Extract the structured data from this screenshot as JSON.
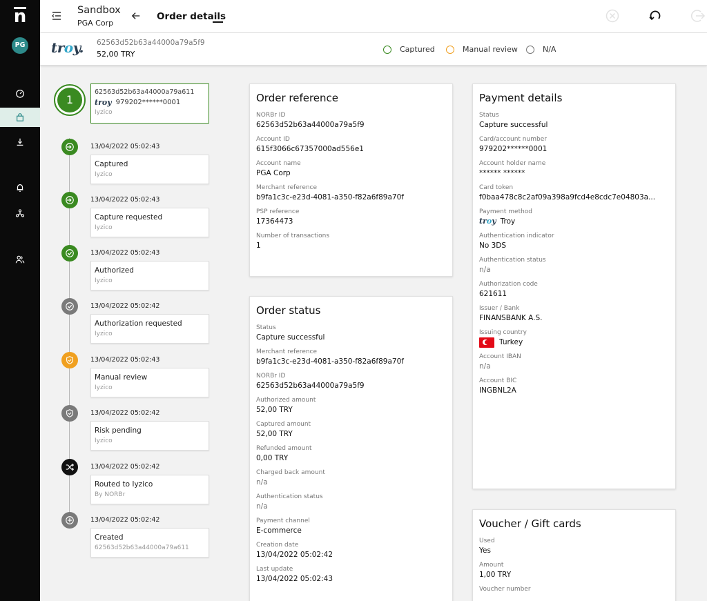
{
  "app": {
    "logo_letter": "n",
    "avatar_initials": "PG"
  },
  "nav": [
    {
      "name": "dashboard",
      "icon": "gauge-icon",
      "active": false
    },
    {
      "name": "orders",
      "icon": "bag-icon",
      "active": true
    },
    {
      "name": "download",
      "icon": "download-icon",
      "active": false
    },
    {
      "name": "alerts",
      "icon": "bell-icon",
      "active": false
    },
    {
      "name": "workflow",
      "icon": "network-icon",
      "active": false
    },
    {
      "name": "users",
      "icon": "users-icon",
      "active": false
    }
  ],
  "header": {
    "org_title": "Sandbox",
    "org_subtitle": "PGA Corp",
    "page_title": "Order details"
  },
  "summary": {
    "brand": "troy",
    "order_id": "62563d52b63a44000a79a5f9",
    "amount": "52,00 TRY",
    "legend": [
      {
        "label": "Captured",
        "color": "#3a8a21"
      },
      {
        "label": "Manual review",
        "color": "#f0a020"
      },
      {
        "label": "N/A",
        "color": "#777777"
      }
    ]
  },
  "timeline": {
    "first": {
      "number": "1",
      "id": "62563d52b63a44000a79a611",
      "card": "979202******0001",
      "psp": "Iyzico"
    },
    "events": [
      {
        "date": "13/04/2022 05:02:43",
        "title": "Captured",
        "sub": "Iyzico",
        "icon": "enter-icon",
        "color": "#3a8a21"
      },
      {
        "date": "13/04/2022 05:02:43",
        "title": "Capture requested",
        "sub": "Iyzico",
        "icon": "enter-icon",
        "color": "#3a8a21"
      },
      {
        "date": "13/04/2022 05:02:43",
        "title": "Authorized",
        "sub": "Iyzico",
        "icon": "check-icon",
        "color": "#3a8a21"
      },
      {
        "date": "13/04/2022 05:02:42",
        "title": "Authorization requested",
        "sub": "Iyzico",
        "icon": "check-icon",
        "color": "#777777"
      },
      {
        "date": "13/04/2022 05:02:43",
        "title": "Manual review",
        "sub": "Iyzico",
        "icon": "shield-check-icon",
        "color": "#f0a020"
      },
      {
        "date": "13/04/2022 05:02:42",
        "title": "Risk pending",
        "sub": "Iyzico",
        "icon": "shield-check-icon",
        "color": "#777777"
      },
      {
        "date": "13/04/2022 05:02:42",
        "title": "Routed to Iyzico",
        "sub": "By NORBr",
        "icon": "shuffle-icon",
        "color": "#111111"
      },
      {
        "date": "13/04/2022 05:02:42",
        "title": "Created",
        "sub": "62563d52b63a44000a79a611",
        "icon": "plus-icon",
        "color": "#777777"
      }
    ]
  },
  "order_reference": {
    "title": "Order reference",
    "fields": [
      {
        "label": "NORBr ID",
        "value": "62563d52b63a44000a79a5f9"
      },
      {
        "label": "Account ID",
        "value": "615f3066c67357000ad556e1"
      },
      {
        "label": "Account name",
        "value": "PGA Corp"
      },
      {
        "label": "Merchant reference",
        "value": "b9fa1c3c-e23d-4081-a350-f82a6f89a70f"
      },
      {
        "label": "PSP reference",
        "value": "17364473"
      },
      {
        "label": "Number of transactions",
        "value": "1"
      }
    ]
  },
  "order_status": {
    "title": "Order status",
    "fields": [
      {
        "label": "Status",
        "value": "Capture successful"
      },
      {
        "label": "Merchant reference",
        "value": "b9fa1c3c-e23d-4081-a350-f82a6f89a70f"
      },
      {
        "label": "NORBr ID",
        "value": "62563d52b63a44000a79a5f9"
      },
      {
        "label": "Authorized amount",
        "value": "52,00 TRY"
      },
      {
        "label": "Captured amount",
        "value": "52,00 TRY"
      },
      {
        "label": "Refunded amount",
        "value": "0,00 TRY"
      },
      {
        "label": "Charged back amount",
        "value": "n/a"
      },
      {
        "label": "Authentication status",
        "value": "n/a"
      },
      {
        "label": "Payment channel",
        "value": "E-commerce"
      },
      {
        "label": "Creation date",
        "value": "13/04/2022 05:02:42"
      },
      {
        "label": "Last update",
        "value": "13/04/2022 05:02:43"
      }
    ]
  },
  "payment_details": {
    "title": "Payment details",
    "fields": [
      {
        "label": "Status",
        "value": "Capture successful"
      },
      {
        "label": "Card/account number",
        "value": "979202******0001"
      },
      {
        "label": "Account holder name",
        "value": "****** ******"
      },
      {
        "label": "Card token",
        "value": "f0baa478c8c2af09a398a9fcd4e8cdc7e04803a..."
      },
      {
        "label": "Payment method",
        "value": "Troy",
        "badge": "troy"
      },
      {
        "label": "Authentication indicator",
        "value": "No 3DS"
      },
      {
        "label": "Authentication status",
        "value": "n/a"
      },
      {
        "label": "Authorization code",
        "value": "621611"
      },
      {
        "label": "Issuer / Bank",
        "value": "FINANSBANK A.S."
      },
      {
        "label": "Issuing country",
        "value": "Turkey",
        "badge": "flag"
      },
      {
        "label": "Account IBAN",
        "value": "n/a"
      },
      {
        "label": "Account BIC",
        "value": "INGBNL2A"
      }
    ]
  },
  "voucher": {
    "title": "Voucher / Gift cards",
    "fields": [
      {
        "label": "Used",
        "value": "Yes"
      },
      {
        "label": "Amount",
        "value": "1,00 TRY"
      },
      {
        "label": "Voucher number",
        "value": ""
      }
    ]
  }
}
